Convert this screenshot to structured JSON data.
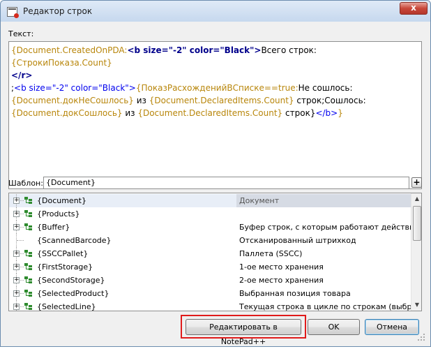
{
  "window": {
    "title": "Редактор строк",
    "close_glyph": "x",
    "icon": "document-icon"
  },
  "text_label": "Текст:",
  "editor": {
    "segments": [
      {
        "t": "{Document.CreatedOnPDA:",
        "c": "y"
      },
      {
        "t": "<b size=\"-2\" color=\"Black\">",
        "c": "bb"
      },
      {
        "t": "Всего строк: ",
        "c": "n"
      },
      {
        "t": "{СтрокиПоказа.Count}",
        "c": "y"
      },
      {
        "t": "\n</r>",
        "c": "bb"
      },
      {
        "t": "\n;",
        "c": "n"
      },
      {
        "t": "<b size=\"-2\" color=\"Black\">",
        "c": "b"
      },
      {
        "t": "{ПоказРасхожденийВСписке==true:",
        "c": "y"
      },
      {
        "t": "Не сошлось:\n",
        "c": "n"
      },
      {
        "t": "{Document.докНеСошлось}",
        "c": "y"
      },
      {
        "t": " из ",
        "c": "n"
      },
      {
        "t": "{Document.DeclaredItems.Count}",
        "c": "y"
      },
      {
        "t": " строк;Сошлось:\n",
        "c": "n"
      },
      {
        "t": "{Document.докСошлось}",
        "c": "y"
      },
      {
        "t": " из ",
        "c": "n"
      },
      {
        "t": "{Document.DeclaredItems.Count}",
        "c": "y"
      },
      {
        "t": " строк}",
        "c": "n"
      },
      {
        "t": "</b>",
        "c": "b"
      },
      {
        "t": "}",
        "c": "y"
      }
    ]
  },
  "template": {
    "label": "Шаблон:",
    "value": "{Document}",
    "plus_label": "+"
  },
  "tree": {
    "rows": [
      {
        "name": "{Document}",
        "desc": "Документ",
        "expandable": true,
        "selected": true
      },
      {
        "name": "{Products}",
        "desc": "",
        "expandable": true,
        "selected": false
      },
      {
        "name": "{Buffer}",
        "desc": "Буфер строк, с которым работают действия ...",
        "expandable": true,
        "selected": false
      },
      {
        "name": "{ScannedBarcode}",
        "desc": "Отсканированный штрихкод",
        "expandable": false,
        "selected": false
      },
      {
        "name": "{SSCCPallet}",
        "desc": "Паллета (SSCC)",
        "expandable": true,
        "selected": false
      },
      {
        "name": "{FirstStorage}",
        "desc": "1-ое место хранения",
        "expandable": true,
        "selected": false
      },
      {
        "name": "{SecondStorage}",
        "desc": "2-ое место хранения",
        "expandable": true,
        "selected": false
      },
      {
        "name": "{SelectedProduct}",
        "desc": "Выбранная позиция товара",
        "expandable": true,
        "selected": false
      },
      {
        "name": "{SelectedLine}",
        "desc": "Текущая строка в цикле по строкам (выбранн...",
        "expandable": true,
        "selected": false
      }
    ],
    "scroll_up": "▲",
    "scroll_down": "▼"
  },
  "buttons": {
    "notepad": "Редактировать в NotePad++",
    "ok": "OK",
    "cancel": "Отмена"
  },
  "colors": {
    "highlight": "#e01b1b",
    "tag_color": "#00008b",
    "field_color": "#b8860b"
  }
}
